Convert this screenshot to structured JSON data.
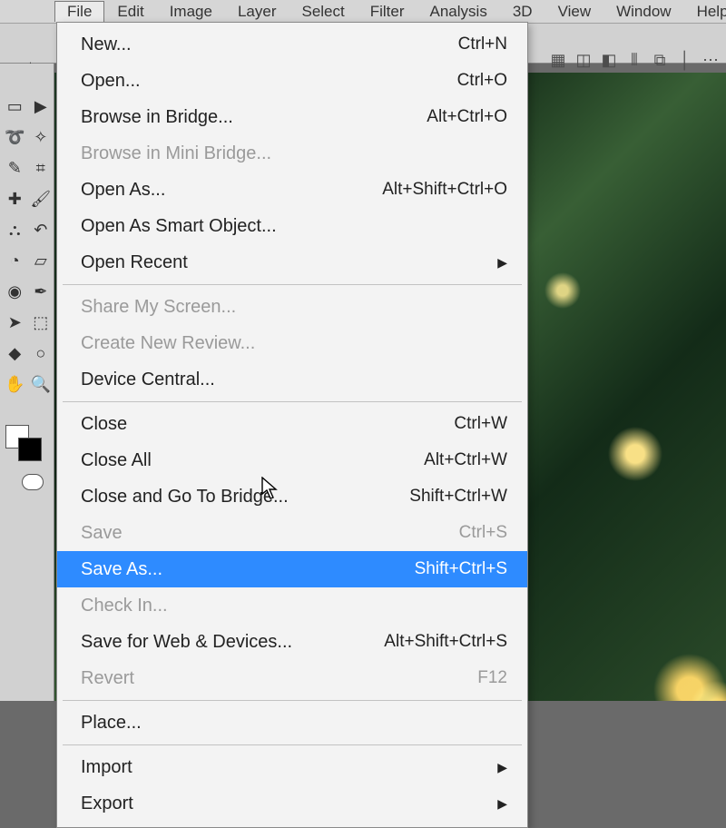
{
  "menubar": {
    "items": [
      "File",
      "Edit",
      "Image",
      "Layer",
      "Select",
      "Filter",
      "Analysis",
      "3D",
      "View",
      "Window",
      "Help"
    ],
    "active_index": 0
  },
  "toolbar_right_icons": [
    "grid-icon",
    "layout-icon",
    "layout2-icon",
    "panel-l-icon",
    "panel-r-icon",
    "divider-icon",
    "more-icon"
  ],
  "tools": {
    "col": [
      [
        "marquee-icon",
        "arrow-right-icon"
      ],
      [
        "lasso-icon",
        "magic-wand-icon"
      ],
      [
        "eyedropper-icon",
        "crop-icon"
      ],
      [
        "healing-icon",
        "brush-icon"
      ],
      [
        "stamp-icon",
        "history-brush-icon"
      ],
      [
        "bucket-icon",
        "eraser-icon"
      ],
      [
        "blur-icon",
        "pen-icon"
      ],
      [
        "pointer-icon",
        "path-select-icon"
      ],
      [
        "shape-icon",
        "shape2-icon"
      ],
      [
        "hand-icon",
        "zoom-icon"
      ]
    ]
  },
  "dropdown": {
    "groups": [
      [
        {
          "label": "New...",
          "shortcut": "Ctrl+N",
          "enabled": true,
          "submenu": false
        },
        {
          "label": "Open...",
          "shortcut": "Ctrl+O",
          "enabled": true,
          "submenu": false
        },
        {
          "label": "Browse in Bridge...",
          "shortcut": "Alt+Ctrl+O",
          "enabled": true,
          "submenu": false
        },
        {
          "label": "Browse in Mini Bridge...",
          "shortcut": "",
          "enabled": false,
          "submenu": false
        },
        {
          "label": "Open As...",
          "shortcut": "Alt+Shift+Ctrl+O",
          "enabled": true,
          "submenu": false
        },
        {
          "label": "Open As Smart Object...",
          "shortcut": "",
          "enabled": true,
          "submenu": false
        },
        {
          "label": "Open Recent",
          "shortcut": "",
          "enabled": true,
          "submenu": true
        }
      ],
      [
        {
          "label": "Share My Screen...",
          "shortcut": "",
          "enabled": false,
          "submenu": false
        },
        {
          "label": "Create New Review...",
          "shortcut": "",
          "enabled": false,
          "submenu": false
        },
        {
          "label": "Device Central...",
          "shortcut": "",
          "enabled": true,
          "submenu": false
        }
      ],
      [
        {
          "label": "Close",
          "shortcut": "Ctrl+W",
          "enabled": true,
          "submenu": false
        },
        {
          "label": "Close All",
          "shortcut": "Alt+Ctrl+W",
          "enabled": true,
          "submenu": false
        },
        {
          "label": "Close and Go To Bridge...",
          "shortcut": "Shift+Ctrl+W",
          "enabled": true,
          "submenu": false
        },
        {
          "label": "Save",
          "shortcut": "Ctrl+S",
          "enabled": false,
          "submenu": false
        },
        {
          "label": "Save As...",
          "shortcut": "Shift+Ctrl+S",
          "enabled": true,
          "submenu": false,
          "selected": true
        },
        {
          "label": "Check In...",
          "shortcut": "",
          "enabled": false,
          "submenu": false
        },
        {
          "label": "Save for Web & Devices...",
          "shortcut": "Alt+Shift+Ctrl+S",
          "enabled": true,
          "submenu": false
        },
        {
          "label": "Revert",
          "shortcut": "F12",
          "enabled": false,
          "submenu": false
        }
      ],
      [
        {
          "label": "Place...",
          "shortcut": "",
          "enabled": true,
          "submenu": false
        }
      ],
      [
        {
          "label": "Import",
          "shortcut": "",
          "enabled": true,
          "submenu": true
        },
        {
          "label": "Export",
          "shortcut": "",
          "enabled": true,
          "submenu": true
        }
      ]
    ]
  }
}
